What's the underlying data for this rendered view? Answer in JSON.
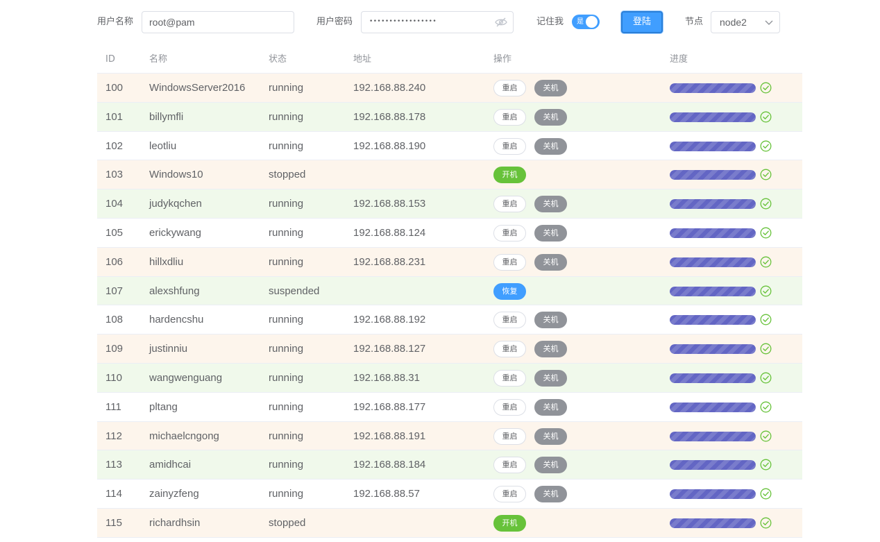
{
  "login": {
    "username_label": "用户名称",
    "username_value": "root@pam",
    "password_label": "用户密码",
    "password_masked": "•••••••••••••••••",
    "remember_label": "记住我",
    "remember_switch_text": "是",
    "remember_on": true,
    "login_button": "登陆",
    "node_label": "节点",
    "node_value": "node2"
  },
  "table": {
    "columns": [
      "ID",
      "名称",
      "状态",
      "地址",
      "操作",
      "进度"
    ],
    "buttons": {
      "restart": "重启",
      "shutdown": "关机",
      "start": "开机",
      "resume": "恢复"
    },
    "rows": [
      {
        "id": "100",
        "name": "WindowsServer2016",
        "state": "running",
        "address": "192.168.88.240",
        "progress": 100
      },
      {
        "id": "101",
        "name": "billymfli",
        "state": "running",
        "address": "192.168.88.178",
        "progress": 100
      },
      {
        "id": "102",
        "name": "leotliu",
        "state": "running",
        "address": "192.168.88.190",
        "progress": 100
      },
      {
        "id": "103",
        "name": "Windows10",
        "state": "stopped",
        "address": "",
        "progress": 100
      },
      {
        "id": "104",
        "name": "judykqchen",
        "state": "running",
        "address": "192.168.88.153",
        "progress": 100
      },
      {
        "id": "105",
        "name": "erickywang",
        "state": "running",
        "address": "192.168.88.124",
        "progress": 100
      },
      {
        "id": "106",
        "name": "hillxdliu",
        "state": "running",
        "address": "192.168.88.231",
        "progress": 100
      },
      {
        "id": "107",
        "name": "alexshfung",
        "state": "suspended",
        "address": "",
        "progress": 100
      },
      {
        "id": "108",
        "name": "hardencshu",
        "state": "running",
        "address": "192.168.88.192",
        "progress": 100
      },
      {
        "id": "109",
        "name": "justinniu",
        "state": "running",
        "address": "192.168.88.127",
        "progress": 100
      },
      {
        "id": "110",
        "name": "wangwenguang",
        "state": "running",
        "address": "192.168.88.31",
        "progress": 100
      },
      {
        "id": "111",
        "name": "pltang",
        "state": "running",
        "address": "192.168.88.177",
        "progress": 100
      },
      {
        "id": "112",
        "name": "michaelcngong",
        "state": "running",
        "address": "192.168.88.191",
        "progress": 100
      },
      {
        "id": "113",
        "name": "amidhcai",
        "state": "running",
        "address": "192.168.88.184",
        "progress": 100
      },
      {
        "id": "114",
        "name": "zainyzfeng",
        "state": "running",
        "address": "192.168.88.57",
        "progress": 100
      },
      {
        "id": "115",
        "name": "richardhsin",
        "state": "stopped",
        "address": "",
        "progress": 100
      }
    ]
  },
  "colors": {
    "primary": "#409eff",
    "success": "#67c23a",
    "info": "#909399",
    "progress": "#6366c4",
    "row_orange": "#fdf5ec",
    "row_green": "#f0f9eb"
  },
  "icons": {
    "password_toggle": "eye-icon",
    "select_arrow": "chevron-down-icon",
    "progress_done": "check-circle-icon"
  }
}
